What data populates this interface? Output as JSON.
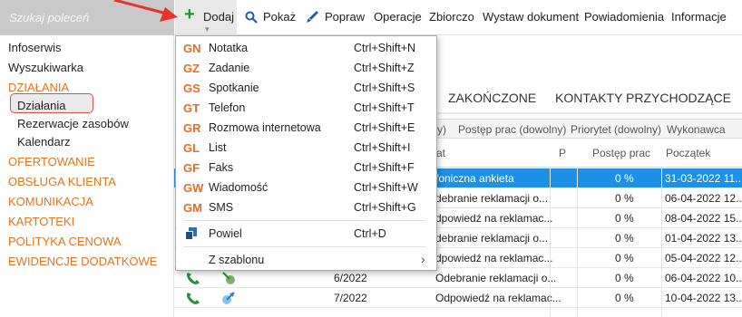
{
  "search": {
    "placeholder": "Szukaj poleceń"
  },
  "toolbar": {
    "dodaj": "Dodaj",
    "pokaz": "Pokaż",
    "popraw": "Popraw",
    "operacje": "Operacje",
    "zbiorczo": "Zbiorczo",
    "wystaw": "Wystaw dokument",
    "powiadomienia": "Powiadomienia",
    "informacje": "Informacje"
  },
  "sidebar": {
    "items": [
      {
        "label": "Infoserwis"
      },
      {
        "label": "Wyszukiwarka"
      },
      {
        "label": "DZIAŁANIA"
      },
      {
        "label": "Działania"
      },
      {
        "label": "Rezerwacje zasobów"
      },
      {
        "label": "Kalendarz"
      },
      {
        "label": "OFERTOWANIE"
      },
      {
        "label": "OBSŁUGA KLIENTA"
      },
      {
        "label": "KOMUNIKACJA"
      },
      {
        "label": "KARTOTEKI"
      },
      {
        "label": "POLITYKA CENOWA"
      },
      {
        "label": "EWIDENCJE DODATKOWE"
      }
    ]
  },
  "menu": {
    "items": [
      {
        "code": "GN",
        "label": "Notatka",
        "shortcut": "Ctrl+Shift+N"
      },
      {
        "code": "GZ",
        "label": "Zadanie",
        "shortcut": "Ctrl+Shift+Z"
      },
      {
        "code": "GS",
        "label": "Spotkanie",
        "shortcut": "Ctrl+Shift+S"
      },
      {
        "code": "GT",
        "label": "Telefon",
        "shortcut": "Ctrl+Shift+T"
      },
      {
        "code": "GR",
        "label": "Rozmowa internetowa",
        "shortcut": "Ctrl+Shift+E"
      },
      {
        "code": "GL",
        "label": "List",
        "shortcut": "Ctrl+Shift+I"
      },
      {
        "code": "GF",
        "label": "Faks",
        "shortcut": "Ctrl+Shift+F"
      },
      {
        "code": "GW",
        "label": "Wiadomość",
        "shortcut": "Ctrl+Shift+W"
      },
      {
        "code": "GM",
        "label": "SMS",
        "shortcut": "Ctrl+Shift+G"
      }
    ],
    "powiel": {
      "label": "Powiel",
      "shortcut": "Ctrl+D"
    },
    "z_szablonu": {
      "label": "Z szablonu"
    }
  },
  "tabs": {
    "zakonczone": "ZAKOŃCZONE",
    "kontakty": "KONTAKTY PRZYCHODZĄCE"
  },
  "filters": {
    "f1": "y)",
    "f2": "Postęp prac (dowolny)",
    "f3": "Priorytet (dowolny)",
    "f4": "Wykonawca"
  },
  "columns": {
    "temat": "at",
    "p": "P",
    "postep": "Postęp prac",
    "poczatek": "Początek"
  },
  "rows": [
    {
      "num": "",
      "temat": "foniczna ankieta",
      "postep": "0 %",
      "poczatek": "31-03-2022 11..."
    },
    {
      "num": "",
      "temat": "debranie reklamacji o...",
      "postep": "0 %",
      "poczatek": "06-04-2022 12..."
    },
    {
      "num": "",
      "temat": "dpowiedź na reklamac...",
      "postep": "0 %",
      "poczatek": "08-04-2022 15..."
    },
    {
      "num": "",
      "temat": "debranie reklamacji o...",
      "postep": "0 %",
      "poczatek": "01-04-2022 13..."
    },
    {
      "num": "",
      "temat": "dpowiedź na reklamac...",
      "postep": "0 %",
      "poczatek": "05-04-2022 12..."
    },
    {
      "num": "6/2022",
      "temat": "Odebranie reklamacji o...",
      "postep": "0 %",
      "poczatek": "06-04-2022 10..."
    },
    {
      "num": "7/2022",
      "temat": "Odpowiedź na reklamac...",
      "postep": "0 %",
      "poczatek": "10-04-2022 13..."
    }
  ],
  "colors": {
    "accent": "#e8721f",
    "selection": "#1e90e6",
    "green": "#2a8f3a",
    "arrow": "#e8322c"
  }
}
